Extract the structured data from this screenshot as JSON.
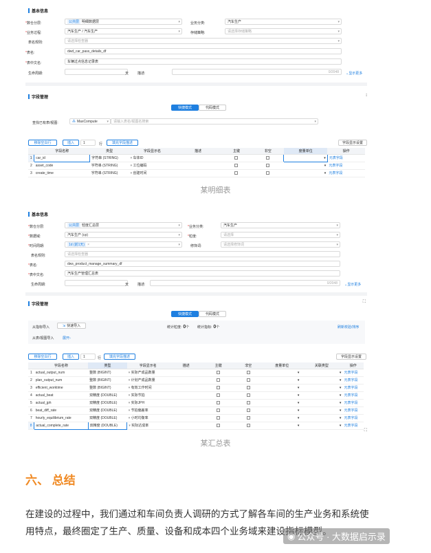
{
  "shot1": {
    "section1_title": "基本信息",
    "data_layer_label": "数仓分层:",
    "data_layer_tag": "公共层",
    "data_layer_value": "明细数据层",
    "biz_class_label": "业务分类:",
    "biz_class_value": "汽车生产",
    "biz_process_label": "业务过程:",
    "biz_process_value": "汽车生产 / 汽车生产",
    "storage_label": "存储策略:",
    "storage_placeholder": "请选择存储策略",
    "table_rule_label": "表名规则:",
    "table_rule_placeholder": "请选择检查器",
    "table_name_label": "表名:",
    "table_name_value": "dwd_car_pass_details_df",
    "table_cn_label": "表中文名:",
    "table_cn_value": "车辆过点信息记录表",
    "lifecycle_label": "生命周期:",
    "lifecycle_unit": "天",
    "desc_label": "描述:",
    "desc_count": "0/2048",
    "show_more": "显示更多",
    "section2_title": "字段管理",
    "mode_quick": "快捷模式",
    "mode_code": "代码模式",
    "lookup_label": "查找已有表/视图:",
    "engine": "MaxCompute",
    "lookup_placeholder": "请输入表名/视图名搜索",
    "move_up_btn": "移除空白行",
    "insert_btn": "插入",
    "insert_count": "1",
    "row_unit": "行",
    "fill_desc_btn": "填充字段描述",
    "display_setting_btn": "字段显示设置",
    "columns": [
      "字段名称",
      "类型",
      "字段显示名",
      "描述",
      "主键",
      "非空",
      "度量单位",
      "操作"
    ],
    "rows": [
      {
        "no": "1",
        "name": "car_id",
        "type": "字符串 (STRING)",
        "display": "车体ID",
        "op": "元表字段"
      },
      {
        "no": "2",
        "name": "asset_code",
        "type": "字符串 (STRING)",
        "display": "工位编码",
        "op": "元表字段"
      },
      {
        "no": "3",
        "name": "create_time",
        "type": "字符串 (STRING)",
        "display": "创建时间",
        "op": "元表字段"
      }
    ]
  },
  "caption1": "某明细表",
  "shot2": {
    "section1_title": "基本信息",
    "data_layer_label": "数仓分层:",
    "data_layer_tag": "公共层",
    "data_layer_value": "轻度汇总层",
    "biz_class_label": "业务分类:",
    "biz_class_value": "汽车生产",
    "data_domain_label": "数据域:",
    "data_domain_value": "汽车生产 (cp)",
    "granularity_label": "粒度:",
    "granularity_placeholder": "请选择",
    "time_period_label": "时间周期:",
    "time_period_tag": "1d (前1天)",
    "modifier_label": "修饰词:",
    "modifier_placeholder": "请选择修饰词",
    "table_rule_label": "表名规则:",
    "table_rule_placeholder": "请选择检查器",
    "table_name_label": "表名:",
    "table_name_value": "dws_product_manage_summary_df",
    "table_cn_label": "表中文名:",
    "table_cn_value": "汽车生产管理汇总表",
    "lifecycle_label": "生命周期:",
    "lifecycle_unit": "天",
    "desc_label": "描述:",
    "desc_count": "0/2048",
    "show_more": "显示更多",
    "section2_title": "字段管理",
    "mode_quick": "快捷模式",
    "mode_code": "代码模式",
    "from_indicator_label": "从指标导入",
    "quick_import": "快速导入",
    "stat_granularity_label": "统计粒度:",
    "stat_granularity_count": "0",
    "stat_indicator_label": "统计指标:",
    "stat_indicator_count": "0",
    "unit_suffix": "个",
    "import_order": "刷新校验/排序",
    "from_table_label": "从表/视图导入",
    "expand": "展开",
    "move_up_btn": "移除空白行",
    "insert_btn": "插入",
    "insert_count": "1",
    "row_unit": "行",
    "fill_desc_btn": "填充字段描述",
    "display_setting_btn": "字段显示设置",
    "columns": [
      "字段名称",
      "类型",
      "字段显示名",
      "描述",
      "主键",
      "非空",
      "度量单位",
      "关联类型",
      "操作"
    ],
    "rows": [
      {
        "no": "1",
        "name": "actual_output_num",
        "type": "整数 (BIGINT)",
        "display": "实际产成品数量",
        "op": "元表字段"
      },
      {
        "no": "2",
        "name": "plan_output_num",
        "type": "整数 (BIGINT)",
        "display": "计划产成品数量",
        "op": "元表字段"
      },
      {
        "no": "3",
        "name": "efficient_worktime",
        "type": "整数 (BIGINT)",
        "display": "有效工作时间",
        "op": "元表字段"
      },
      {
        "no": "4",
        "name": "actual_beat",
        "type": "双精度 (DOUBLE)",
        "display": "实际节拍",
        "op": "元表字段"
      },
      {
        "no": "5",
        "name": "actual_jph",
        "type": "双精度 (DOUBLE)",
        "display": "实际JPH",
        "op": "元表字段"
      },
      {
        "no": "6",
        "name": "beat_diff_rate",
        "type": "双精度 (DOUBLE)",
        "display": "节拍偏差率",
        "op": "元表字段"
      },
      {
        "no": "7",
        "name": "hourly_equilibrium_rate",
        "type": "双精度 (DOUBLE)",
        "display": "小时均衡率",
        "op": "元表字段"
      },
      {
        "no": "8",
        "name": "actual_complete_rate",
        "type": "双精度 (DOUBLE)",
        "display": "实际达成率",
        "op": "元表字段"
      }
    ]
  },
  "caption2": "某汇总表",
  "heading": "六、 总结",
  "paragraph": "在建设的过程中，我们通过和车间负责人调研的方式了解各车间的生产业务和系统使用特点，最终圈定了生产、质量、设备和成本四个业务域来建设指标模型。",
  "watermark": "公众号 · 大数据启示录"
}
